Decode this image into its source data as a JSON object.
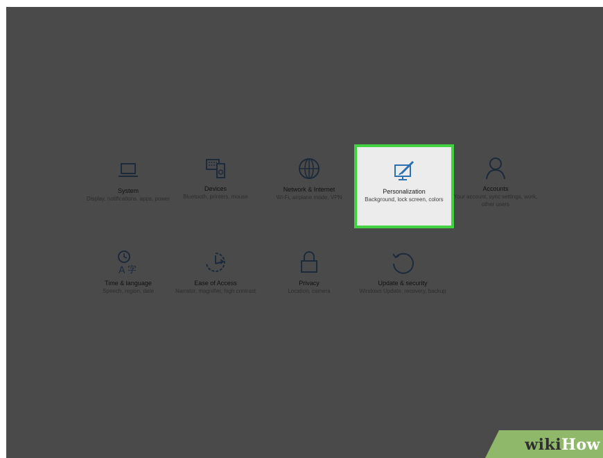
{
  "settings": {
    "tiles": [
      {
        "title": "System",
        "desc": "Display, notifications, apps, power",
        "icon": "laptop-icon"
      },
      {
        "title": "Devices",
        "desc": "Bluetooth, printers, mouse",
        "icon": "keyboard-devices-icon"
      },
      {
        "title": "Network & Internet",
        "desc": "Wi-Fi, airplane mode, VPN",
        "icon": "globe-icon"
      },
      {
        "title": "Personalization",
        "desc": "Background, lock screen, colors",
        "icon": "paintbrush-monitor-icon"
      },
      {
        "title": "Accounts",
        "desc": "Your account, sync settings, work, other users",
        "icon": "person-icon"
      },
      {
        "title": "Time & language",
        "desc": "Speech, region, date",
        "icon": "clock-language-icon"
      },
      {
        "title": "Ease of Access",
        "desc": "Narrator, magnifier, high contrast",
        "icon": "ease-of-access-icon"
      },
      {
        "title": "Privacy",
        "desc": "Location, camera",
        "icon": "lock-icon"
      },
      {
        "title": "Update & security",
        "desc": "Windows Update, recovery, backup",
        "icon": "refresh-icon"
      }
    ],
    "selected": "Personalization",
    "highlight_color": "#42d241",
    "overlay_color": "#4a4a4a"
  },
  "watermark": {
    "part1": "wiki",
    "part2": "How",
    "color": "#8fb86b"
  }
}
